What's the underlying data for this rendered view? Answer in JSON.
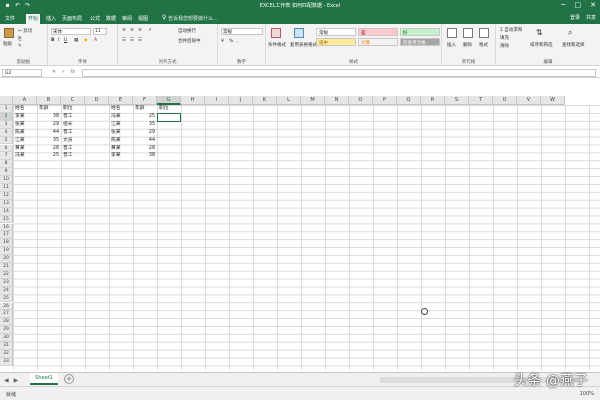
{
  "window": {
    "title": "EXCEL工作表 如何匹配数据 - Excel",
    "controls": [
      "─",
      "□",
      "✕"
    ]
  },
  "tabs": {
    "file": "文件",
    "items": [
      "开始",
      "插入",
      "页面布局",
      "公式",
      "数据",
      "审阅",
      "视图"
    ],
    "tell_me": "告诉我您想要做什么...",
    "signin": "登录",
    "share": "共享"
  },
  "ribbon": {
    "clipboard": {
      "label": "剪贴板",
      "paste": "粘贴",
      "cut": "✂ 剪切"
    },
    "font": {
      "label": "字体",
      "name": "宋体",
      "size": "11"
    },
    "alignment": {
      "label": "对齐方式",
      "wrap": "自动换行",
      "merge": "合并后居中"
    },
    "number": {
      "label": "数字",
      "format": "常规"
    },
    "styles": {
      "label": "样式",
      "cond": "条件格式",
      "table": "套用表格格式",
      "normal": "常规",
      "bad": "差",
      "good": "好",
      "neutral": "适中",
      "calc": "计算",
      "check": "检查单元格"
    },
    "cells": {
      "label": "单元格",
      "insert": "插入",
      "delete": "删除",
      "format": "格式"
    },
    "editing": {
      "label": "编辑",
      "autosum": "Σ 自动求和",
      "fill": "填充",
      "clear": "清除",
      "sort": "排序和筛选",
      "find": "查找和选择"
    }
  },
  "formula_bar": {
    "name_box": "G2",
    "value": ""
  },
  "columns": [
    "A",
    "B",
    "C",
    "D",
    "E",
    "F",
    "G",
    "H",
    "I",
    "J",
    "K",
    "L",
    "M",
    "N",
    "O",
    "P",
    "Q",
    "R",
    "S",
    "T",
    "U",
    "V",
    "W"
  ],
  "selected_column": "G",
  "selected_row": "2",
  "rows": [
    "1",
    "2",
    "3",
    "4",
    "5",
    "6",
    "7",
    "8",
    "9",
    "10",
    "11",
    "12",
    "13",
    "14",
    "15",
    "16",
    "17",
    "18",
    "19",
    "20",
    "21",
    "22",
    "23",
    "24",
    "25",
    "26",
    "27",
    "28",
    "29",
    "30",
    "31",
    "32",
    "33"
  ],
  "table1": {
    "headers": [
      "姓名",
      "年龄",
      "职位"
    ],
    "rows": [
      [
        "李某",
        "38",
        "普工"
      ],
      [
        "张某",
        "29",
        "组长"
      ],
      [
        "陈某",
        "44",
        "普工"
      ],
      [
        "江某",
        "35",
        "文员"
      ],
      [
        "黄某",
        "28",
        "普工"
      ],
      [
        "冯某",
        "25",
        "普工"
      ]
    ]
  },
  "table2": {
    "headers": [
      "姓名",
      "年龄",
      "职位"
    ],
    "rows": [
      [
        "冯某",
        "25"
      ],
      [
        "江某",
        "35"
      ],
      [
        "张某",
        "29"
      ],
      [
        "陈某",
        "44"
      ],
      [
        "黄某",
        "28"
      ],
      [
        "李某",
        "38"
      ]
    ]
  },
  "sheet": {
    "tab": "Sheet1",
    "add": "+"
  },
  "status": {
    "ready": "就绪",
    "zoom": "100%"
  },
  "watermark": "头条 @燕子"
}
